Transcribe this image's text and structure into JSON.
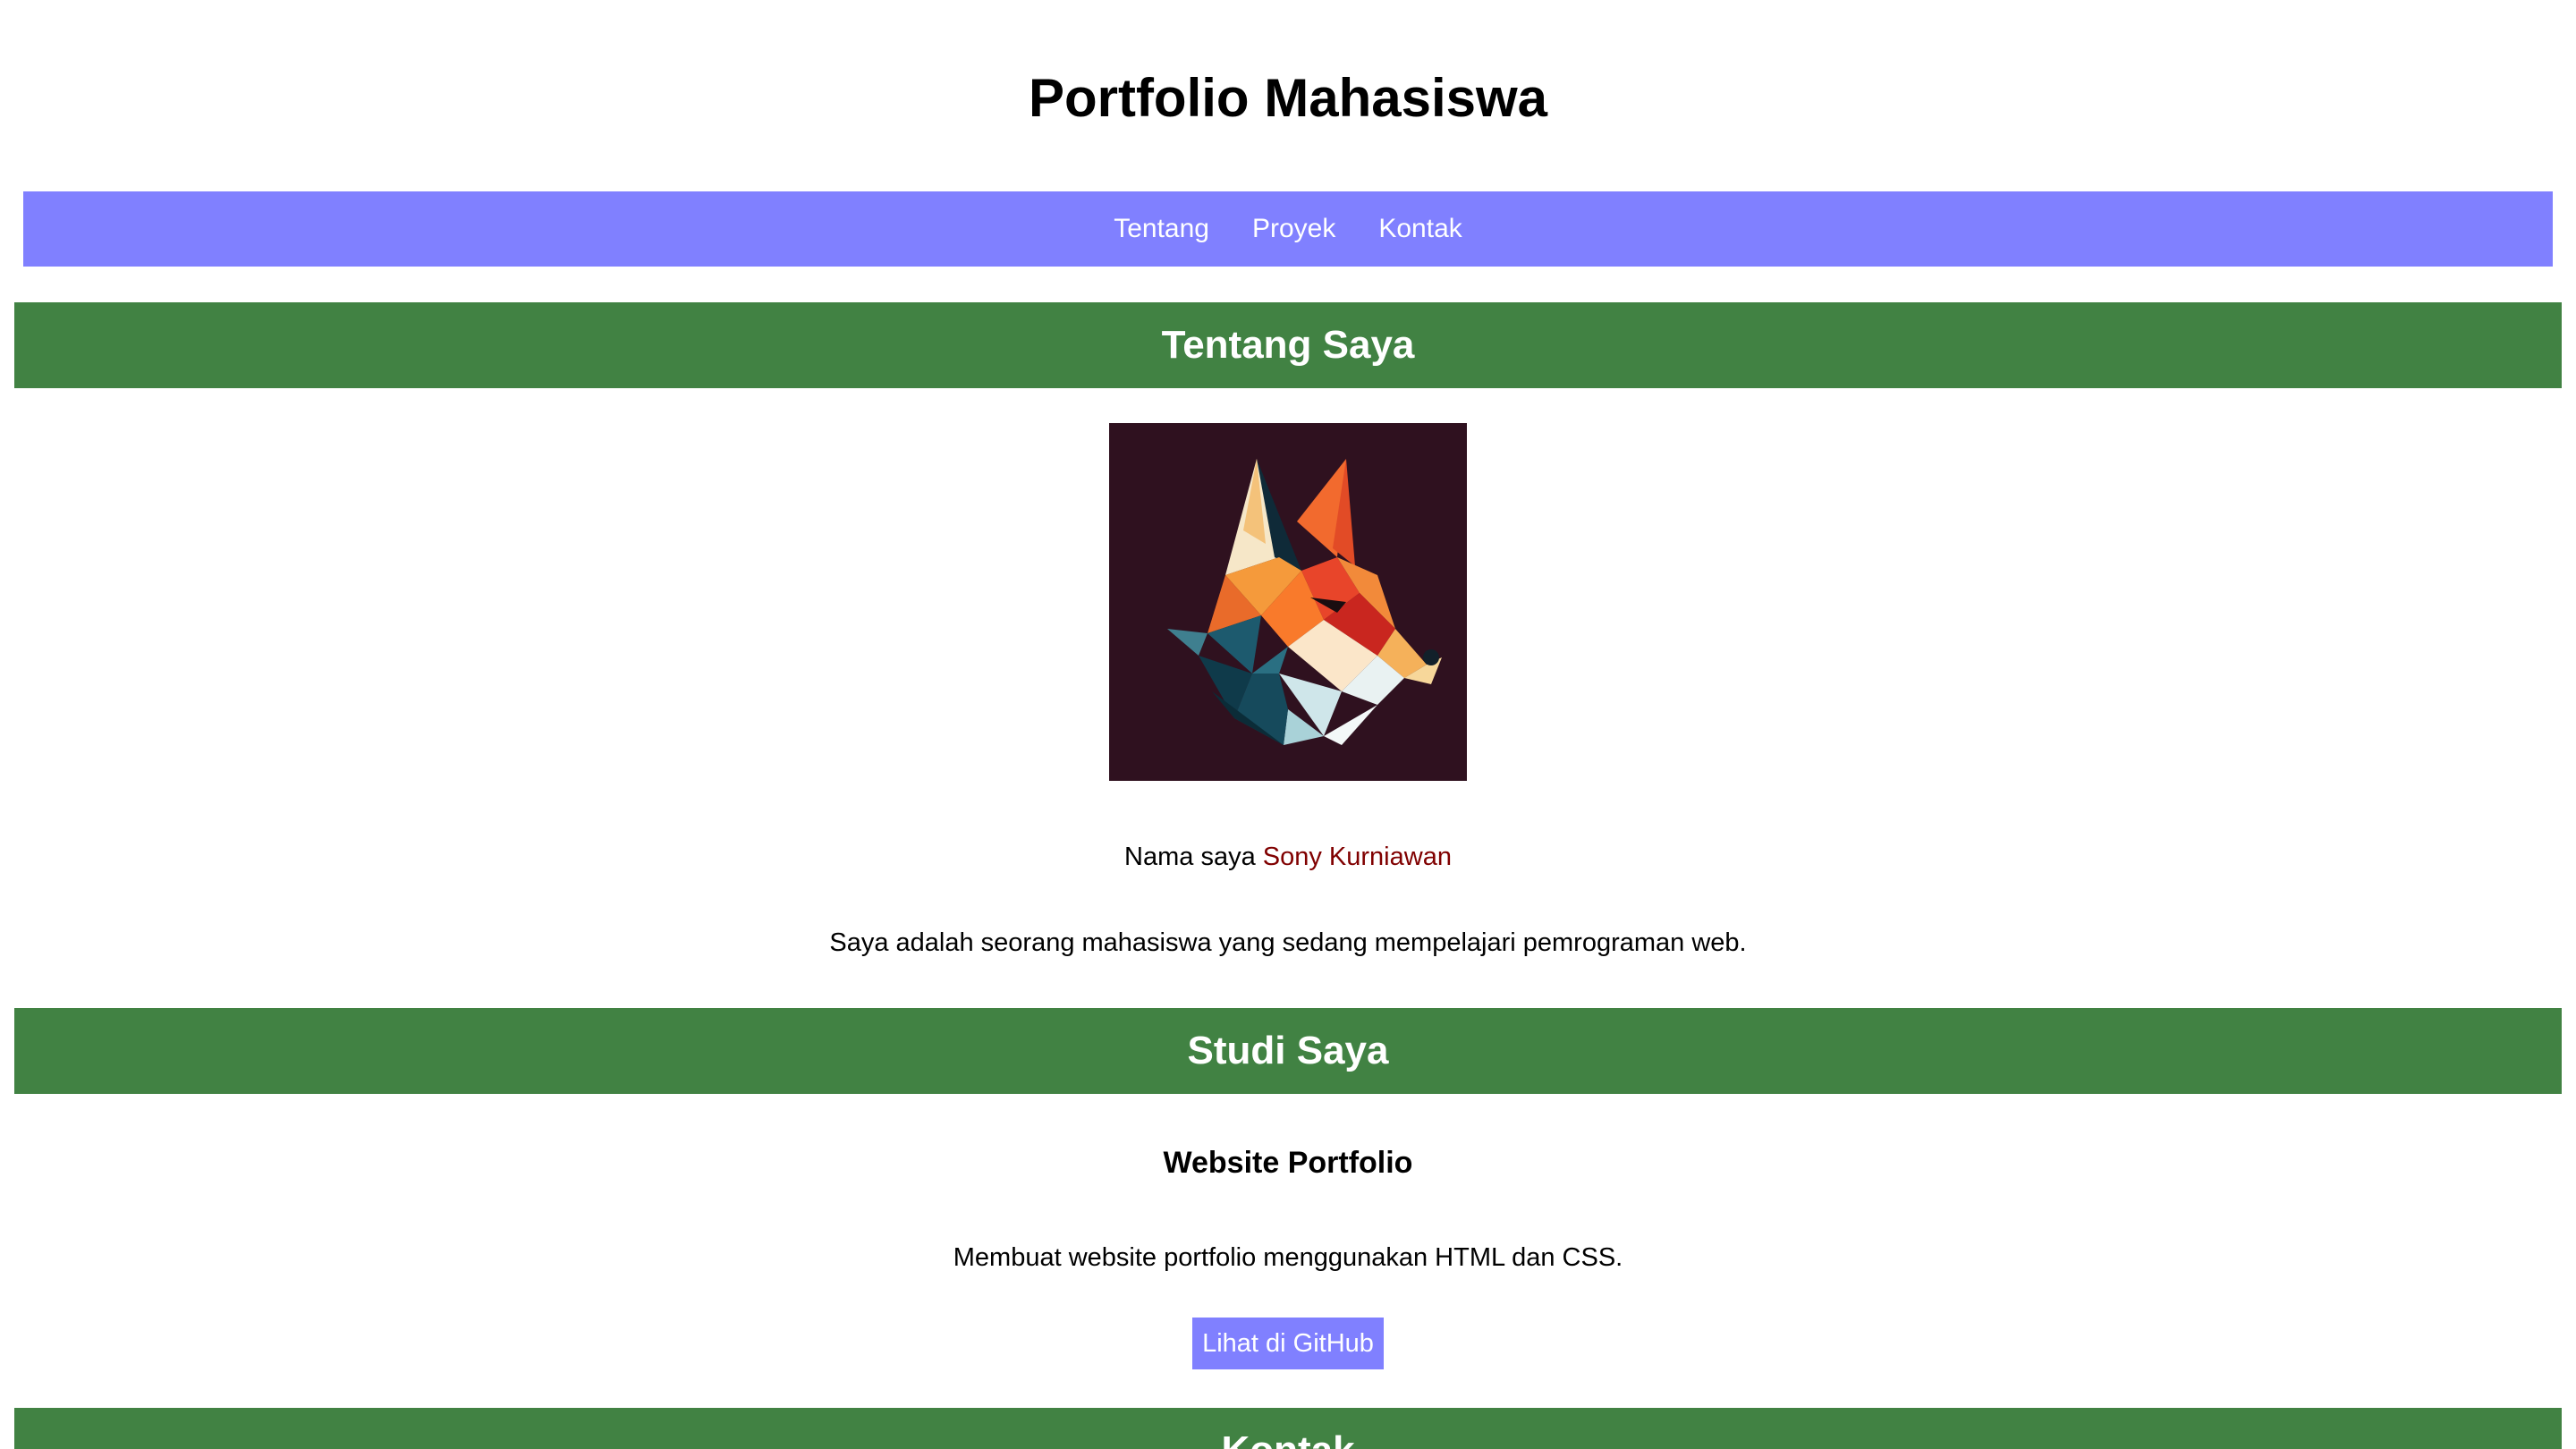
{
  "header": {
    "title": "Portfolio Mahasiswa"
  },
  "nav": {
    "items": [
      "Tentang",
      "Proyek",
      "Kontak"
    ]
  },
  "about": {
    "heading": "Tentang Saya",
    "name_prefix": "Nama saya",
    "name": "Sony Kurniawan",
    "description": "Saya adalah seorang mahasiswa yang sedang mempelajari pemrograman web."
  },
  "studies": {
    "heading": "Studi Saya",
    "project_title": "Website Portfolio",
    "project_description": "Membuat website portfolio menggunakan HTML dan CSS.",
    "github_button": "Lihat di GitHub"
  },
  "contact": {
    "heading": "Kontak"
  },
  "colors": {
    "nav_background": "#8080ff",
    "section_background": "#418243",
    "name_color": "#800000",
    "image_background": "#2f111f"
  }
}
